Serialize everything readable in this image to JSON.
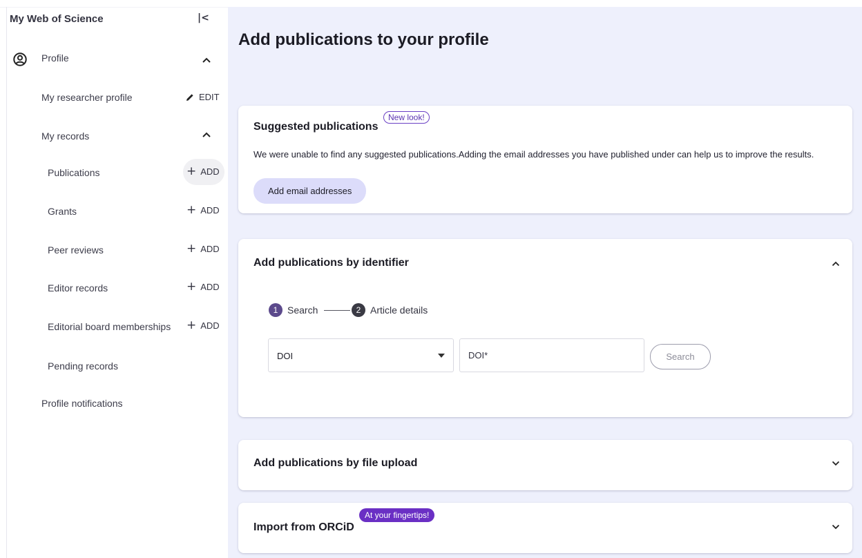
{
  "sidebar": {
    "title": "My Web of Science",
    "collapse_glyph": "|<",
    "profile_label": "Profile",
    "researcher_profile_label": "My researcher profile",
    "edit_label": "EDIT",
    "my_records_label": "My records",
    "records": [
      {
        "label": "Publications",
        "action": "ADD"
      },
      {
        "label": "Grants",
        "action": "ADD"
      },
      {
        "label": "Peer reviews",
        "action": "ADD"
      },
      {
        "label": "Editor records",
        "action": "ADD"
      },
      {
        "label": "Editorial board memberships",
        "action": "ADD"
      }
    ],
    "pending_label": "Pending records",
    "notifications_label": "Profile notifications",
    "icons": {
      "profile": "account-circle-icon",
      "edit": "pencil-icon",
      "add": "plus-icon",
      "chevron": "chevron-up-icon"
    }
  },
  "main": {
    "title": "Add publications to your profile",
    "suggested": {
      "title": "Suggested publications",
      "badge": "New look!",
      "text": "We were unable to find any suggested publications.Adding the email addresses you have published under can help us to improve the results.",
      "button": "Add email addresses"
    },
    "identifier": {
      "title": "Add publications by identifier",
      "steps": [
        {
          "num": "1",
          "label": "Search"
        },
        {
          "num": "2",
          "label": "Article details"
        }
      ],
      "select_value": "DOI",
      "input_placeholder": "DOI*",
      "search_button": "Search"
    },
    "file_upload": {
      "title": "Add publications by file upload"
    },
    "orcid": {
      "title": "Import from ORCiD",
      "badge": "At your fingertips!"
    }
  },
  "colors": {
    "accent": "#6a2fc4",
    "step_active": "#5c4a8c",
    "step_inactive": "#3a3a44",
    "main_bg": "#eef0fc",
    "button_bg": "#dcdcfa"
  }
}
